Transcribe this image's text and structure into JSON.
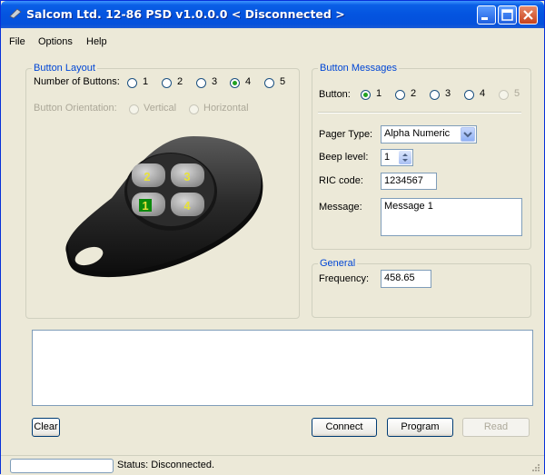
{
  "window": {
    "title": "Salcom Ltd. 12-86 PSD v1.0.0.0 < Disconnected >"
  },
  "menu": {
    "items": [
      "File",
      "Options",
      "Help"
    ]
  },
  "button_layout": {
    "legend": "Button Layout",
    "num_buttons_label": "Number of Buttons:",
    "num_options": [
      "1",
      "2",
      "3",
      "4",
      "5"
    ],
    "num_selected": "4",
    "orientation_label": "Button Orientation:",
    "orientation_options": [
      "Vertical",
      "Horizontal"
    ],
    "keyfob_keys": [
      "2",
      "3",
      "1",
      "4"
    ],
    "colors": {
      "key_label": "#e8e23a",
      "active_key": "#0c8a0c"
    }
  },
  "button_messages": {
    "legend": "Button Messages",
    "button_label": "Button:",
    "button_options": [
      "1",
      "2",
      "3",
      "4",
      "5"
    ],
    "button_selected": "1",
    "pager_type_label": "Pager Type:",
    "pager_type_value": "Alpha Numeric",
    "beep_label": "Beep level:",
    "beep_value": "1",
    "ric_label": "RIC code:",
    "ric_value": "1234567",
    "message_label": "Message:",
    "message_value": "Message 1"
  },
  "general": {
    "legend": "General",
    "frequency_label": "Frequency:",
    "frequency_value": "458.65"
  },
  "buttons": {
    "clear": "Clear",
    "connect": "Connect",
    "program": "Program",
    "read": "Read"
  },
  "status": {
    "text": "Status: Disconnected."
  },
  "theme": {
    "title_bar": "#0454e0",
    "group_legend": "#0046d5",
    "radio_dot": "#21a121"
  }
}
